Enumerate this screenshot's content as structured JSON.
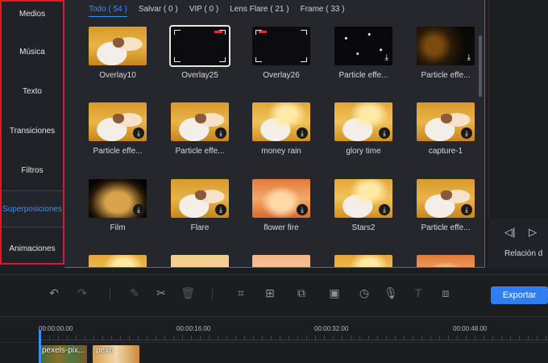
{
  "sidebar": {
    "items": [
      {
        "label": "Medios"
      },
      {
        "label": "Música"
      },
      {
        "label": "Texto"
      },
      {
        "label": "Transiciones"
      },
      {
        "label": "Filtros"
      },
      {
        "label": "Superposiciones",
        "active": true
      },
      {
        "label": "Animaciones"
      }
    ]
  },
  "library": {
    "tabs": [
      {
        "label": "Todo ( 54 )",
        "active": true
      },
      {
        "label": "Salvar ( 0 )"
      },
      {
        "label": "VIP ( 0 )"
      },
      {
        "label": "Lens Flare ( 21 )"
      },
      {
        "label": "Frame ( 33 )"
      }
    ],
    "items": [
      {
        "label": "Overlay10"
      },
      {
        "label": "Overlay25"
      },
      {
        "label": "Overlay26"
      },
      {
        "label": "Particle effe..."
      },
      {
        "label": "Particle effe..."
      },
      {
        "label": "Particle effe..."
      },
      {
        "label": "Particle effe..."
      },
      {
        "label": "money rain"
      },
      {
        "label": "glory time"
      },
      {
        "label": "capture-1"
      },
      {
        "label": "Film"
      },
      {
        "label": "Flare"
      },
      {
        "label": "flower fire"
      },
      {
        "label": "Stars2"
      },
      {
        "label": "Particle effe..."
      }
    ]
  },
  "preview": {
    "ratio_label": "Relación d"
  },
  "toolbar": {
    "export_label": "Exportar"
  },
  "timeline": {
    "times": [
      "00:00:00.00",
      "00:00:16.00",
      "00:00:32.00",
      "00:00:48.00"
    ],
    "clips": [
      {
        "label": "pexels-pix..."
      },
      {
        "label": "pexe"
      }
    ]
  },
  "colors": {
    "accent": "#3c8ef5",
    "export": "#2f7ff0",
    "highlight_border": "#e0182a"
  }
}
